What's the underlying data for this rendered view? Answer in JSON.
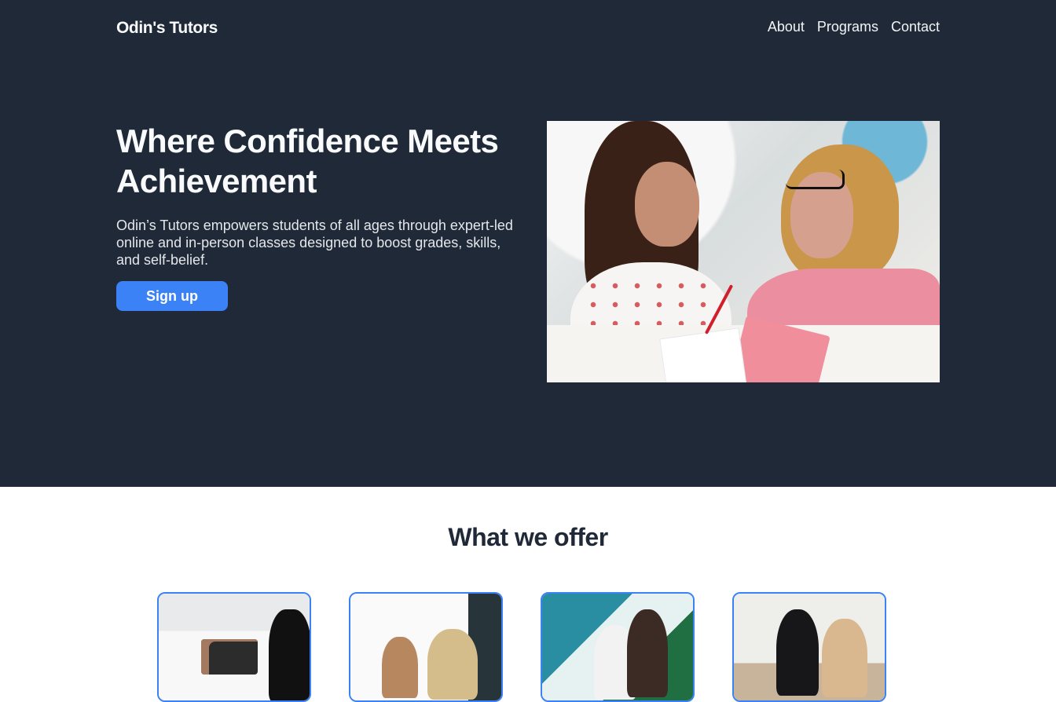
{
  "header": {
    "brand": "Odin's Tutors",
    "nav": [
      "About",
      "Programs",
      "Contact"
    ]
  },
  "hero": {
    "title": "Where Confidence Meets Achievement",
    "description": "Odin’s Tutors empowers students of all ages through expert-led online and in-person classes designed to boost grades, skills, and self-belief.",
    "signup_label": "Sign up",
    "image": "tutor-and-student-photo"
  },
  "offer": {
    "title": "What we offer",
    "cards": [
      {
        "image": "online-learning-photo"
      },
      {
        "image": "group-study-photo"
      },
      {
        "image": "mentoring-photo"
      },
      {
        "image": "one-on-one-tutoring-photo"
      }
    ]
  },
  "colors": {
    "hero_background": "#1f2937",
    "accent": "#3b82f6",
    "heading_dark": "#1f2937"
  }
}
